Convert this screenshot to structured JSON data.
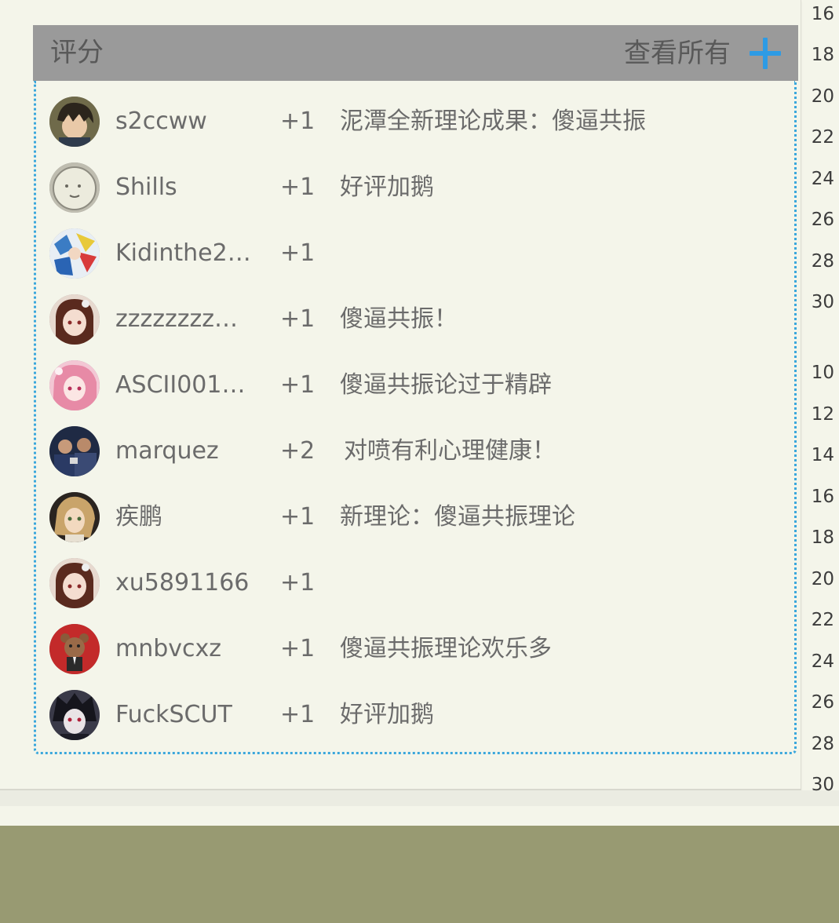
{
  "rating_panel": {
    "title": "评分",
    "view_all_label": "查看所有",
    "accent_color": "#2e9be4",
    "rows": [
      {
        "username": "s2ccww",
        "score": "+1",
        "reason": "泥潭全新理论成果：傻逼共振",
        "avatar_icon": "dark-hair-boy-avatar"
      },
      {
        "username": "Shills",
        "score": "+1",
        "reason": "好评加鹅",
        "avatar_icon": "pale-round-face-avatar"
      },
      {
        "username": "Kidinthe2…",
        "score": "+1",
        "reason": "",
        "avatar_icon": "colorful-anime-avatar"
      },
      {
        "username": "zzzzzzzz…",
        "score": "+1",
        "reason": "傻逼共振！",
        "avatar_icon": "brown-hair-girl-avatar"
      },
      {
        "username": "ASCII001…",
        "score": "+1",
        "reason": "傻逼共振论过于精辟",
        "avatar_icon": "pink-hair-girl-avatar"
      },
      {
        "username": "marquez",
        "score": "+2",
        "reason": "对喷有利心理健康！",
        "avatar_icon": "group-photo-avatar"
      },
      {
        "username": "疾鹏",
        "score": "+1",
        "reason": "新理论：傻逼共振理论",
        "avatar_icon": "blonde-anime-avatar"
      },
      {
        "username": "xu5891166",
        "score": "+1",
        "reason": "",
        "avatar_icon": "brown-hair-girl-avatar"
      },
      {
        "username": "mnbvcxz",
        "score": "+1",
        "reason": "傻逼共振理论欢乐多",
        "avatar_icon": "bear-mascot-avatar"
      },
      {
        "username": "FuckSCUT",
        "score": "+1",
        "reason": "好评加鹅",
        "avatar_icon": "masked-anime-avatar"
      }
    ]
  },
  "line_numbers": [
    "16",
    "18",
    "20",
    "22",
    "24",
    "26",
    "28",
    "30",
    "10",
    "12",
    "14",
    "16",
    "18",
    "20",
    "22",
    "24",
    "26",
    "28",
    "30"
  ]
}
